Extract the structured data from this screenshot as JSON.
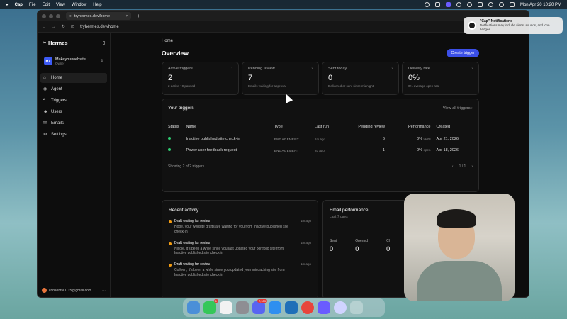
{
  "menubar": {
    "app": "Cap",
    "menus": [
      "File",
      "Edit",
      "View",
      "Window",
      "Help"
    ],
    "datetime": "Mon Apr 20  10:20 PM"
  },
  "browser": {
    "tab_title": "tryhermes.dev/home",
    "url": "tryhermes.dev/home"
  },
  "sidebar": {
    "brand": "Hermes",
    "workspace": {
      "initials": "MA",
      "name": "Makeyourwebsite",
      "role": "Owner"
    },
    "items": [
      {
        "label": "Home",
        "icon": "home-icon"
      },
      {
        "label": "Agent",
        "icon": "agent-icon"
      },
      {
        "label": "Triggers",
        "icon": "triggers-icon"
      },
      {
        "label": "Users",
        "icon": "users-icon"
      },
      {
        "label": "Emails",
        "icon": "mail-icon"
      },
      {
        "label": "Settings",
        "icon": "gear-icon"
      }
    ],
    "account_email": "consentiv0715@gmail.com"
  },
  "main": {
    "breadcrumb": "Home",
    "title": "Overview",
    "create_button": "Create trigger",
    "stats": [
      {
        "label": "Active triggers",
        "value": "2",
        "sub": "2 active • 0 paused"
      },
      {
        "label": "Pending review",
        "value": "7",
        "sub": "Emails waiting for approval"
      },
      {
        "label": "Sent today",
        "value": "0",
        "sub": "Delivered or sent since midnight"
      },
      {
        "label": "Delivery rate",
        "value": "0%",
        "sub": "0% average open rate"
      }
    ],
    "triggers": {
      "title": "Your triggers",
      "view_all": "View all triggers",
      "columns": [
        "Status",
        "Name",
        "Type",
        "Last run",
        "Pending review",
        "Performance",
        "Created"
      ],
      "rows": [
        {
          "name": "Inactive published site check-in",
          "type": "ENGAGEMENT",
          "last_run": "1m ago",
          "pending": "6",
          "performance": "0%",
          "perf_sub": "open",
          "created": "Apr 21, 2026"
        },
        {
          "name": "Power user feedback request",
          "type": "ENGAGEMENT",
          "last_run": "2d ago",
          "pending": "1",
          "performance": "0%",
          "perf_sub": "open",
          "created": "Apr 18, 2026"
        }
      ],
      "footer": "Showing 2 of 2 triggers",
      "page": "1 / 1"
    },
    "activity": {
      "title": "Recent activity",
      "items": [
        {
          "title": "Draft waiting for review",
          "time": "1m ago",
          "body": "Hope, your website drafts are waiting for you from Inactive published site check-in"
        },
        {
          "title": "Draft waiting for review",
          "time": "1m ago",
          "body": "Nicole, it's been a while since you last updated your portfolio site from Inactive published site check-in"
        },
        {
          "title": "Draft waiting for review",
          "time": "1m ago",
          "body": "Colleen, it's been a while since you updated your micoaching site from Inactive published site check-in"
        }
      ]
    },
    "email_performance": {
      "title": "Email performance",
      "period": "Last 7 days",
      "metrics": [
        {
          "label": "Sent",
          "value": "0"
        },
        {
          "label": "Opened",
          "value": "0"
        },
        {
          "label": "Cl",
          "value": "0"
        }
      ]
    }
  },
  "notification": {
    "title": "\"Cap\" Notifications",
    "body": "Notifications may include alerts, sounds, and icon badges."
  },
  "dock": {
    "badges": [
      "1",
      "7,109"
    ]
  },
  "colors": {
    "accent": "#3b4fe8",
    "active_dot": "#2ecc71",
    "activity_dot": "#f39c12"
  }
}
